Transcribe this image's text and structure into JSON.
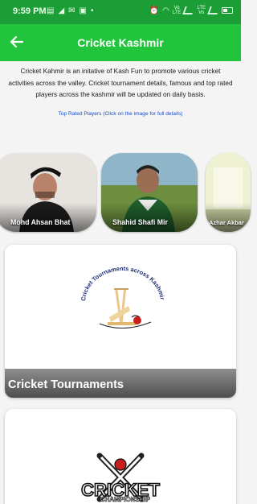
{
  "status_bar": {
    "time": "9:59 PM",
    "icons": [
      "cast-icon",
      "telegram-icon",
      "mail-icon",
      "notification-icon",
      "dot-icon"
    ],
    "right_icons": [
      "alarm-icon",
      "wifi-icon",
      "network-vo-lte-icon",
      "signal-icon",
      "battery-icon"
    ]
  },
  "app_bar": {
    "title": "Cricket Kashmir",
    "back_icon": "arrow-left-icon"
  },
  "intro": {
    "text": "Cricket Kahmir is an initative of Kash Fun to promote various cricket activities across the valley. Cricket tournament details, famous and top rated players across the kashmir will be updated on daily basis.",
    "link_text": "Top Rated Players (Click on the image for full details)"
  },
  "players": [
    {
      "name": "Mohd Ahsan Bhat"
    },
    {
      "name": "Shahid Shafi Mir"
    },
    {
      "name": "Azhar Akbar"
    }
  ],
  "sections": [
    {
      "label": "Cricket Tournaments",
      "logo_text": "Cricket Tournaments across Kashmir"
    },
    {
      "logo_text": "CRICKET",
      "logo_subtext": "CHAMPIONSHIP"
    }
  ],
  "colors": {
    "status_bar": "#1b9e35",
    "app_bar": "#20c53b",
    "link": "#1a4ec8"
  }
}
